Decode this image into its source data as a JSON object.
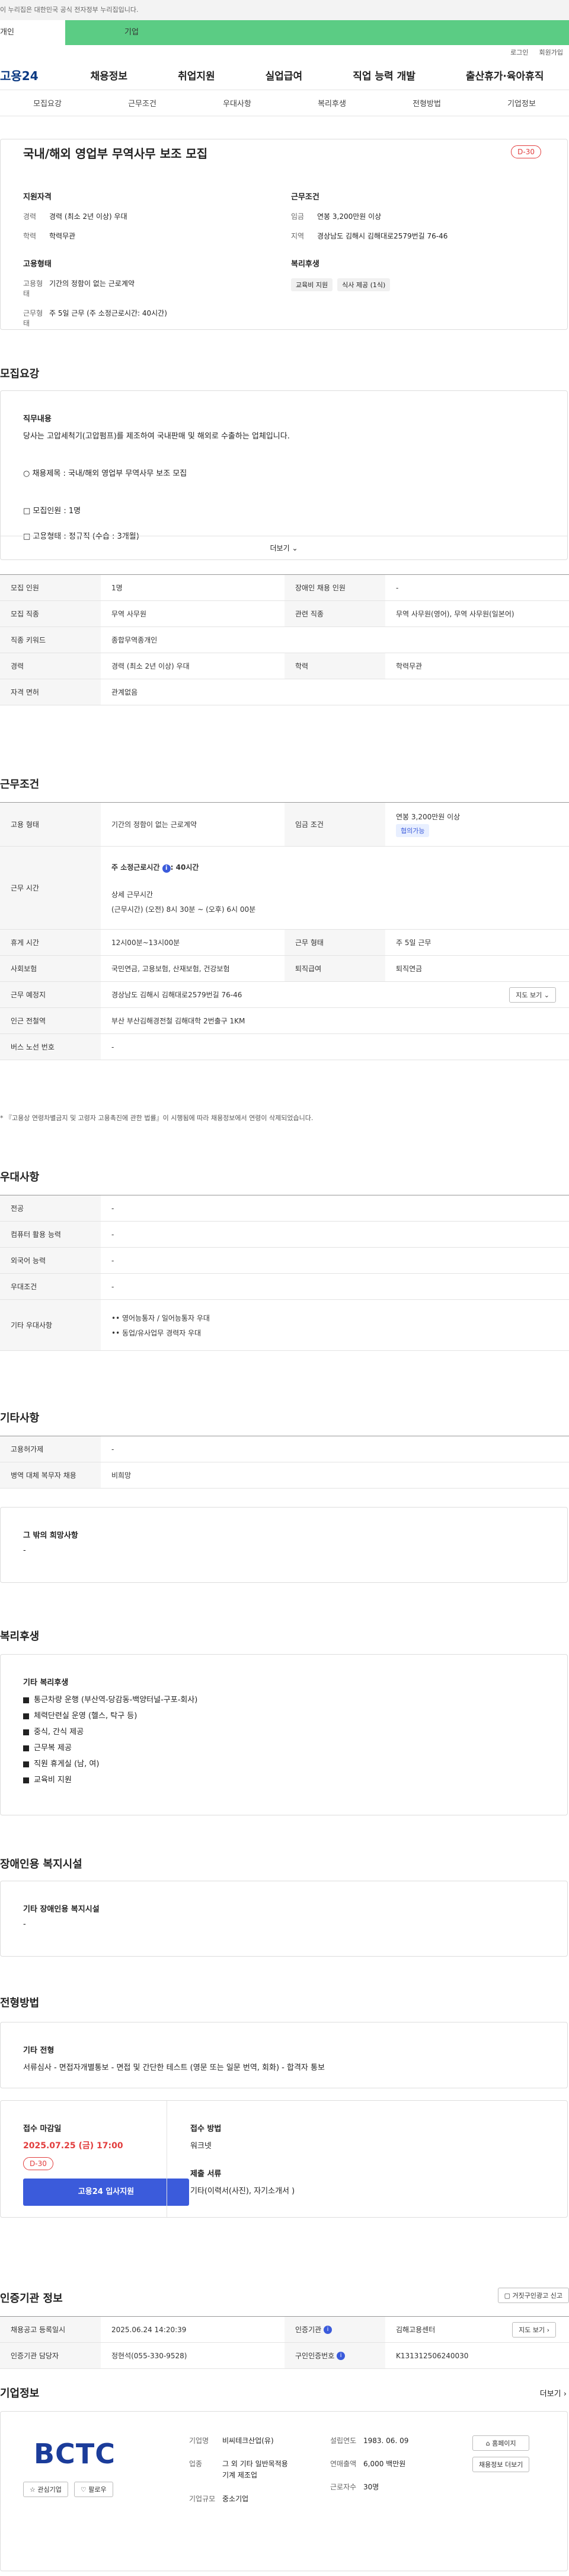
{
  "govbar": "이 누리집은 대한민국 공식 전자정부 누리집입니다.",
  "usertabs": [
    "개인",
    "기업"
  ],
  "top_links": [
    "로그인",
    "회원가입"
  ],
  "logo": "고용24",
  "gnb": [
    "채용정보",
    "취업지원",
    "실업급여",
    "직업 능력 개발",
    "출산휴가·육아휴직"
  ],
  "subnav": [
    "모집요강",
    "근무조건",
    "우대사항",
    "복리후생",
    "전형방법",
    "기업정보"
  ],
  "summary": {
    "title": "국내/해외 영업부 무역사무 보조 모집",
    "dday": "D-30",
    "qual_title": "지원자격",
    "career_k": "경력",
    "career_v": "경력 (최소 2년 이상) 우대",
    "edu_k": "학력",
    "edu_v": "학력무관",
    "cond_title": "근무조건",
    "wage_k": "임금",
    "wage_v": "연봉 3,200만원 이상",
    "area_k": "지역",
    "area_v": "경상남도 김해시 김해대로2579번길 76-46",
    "emp_title": "고용형태",
    "emptype_k": "고용형태",
    "emptype_v": "기간의 정함이 없는 근로계약",
    "workform_k": "근무형태",
    "workform_v": "주 5일 근무 (주 소정근로시간: 40시간)",
    "welfare_title": "복리후생",
    "chips": [
      "교육비 지원",
      "식사 제공 (1식)"
    ]
  },
  "recruit": {
    "title": "모집요강",
    "duty_title": "직무내용",
    "duty_desc": "당사는 고압세척기(고압펌프)를 제조하여 국내판매 및 해외로 수출하는 업체입니다.",
    "lines": [
      "○ 채용제목 : 국내/해외 영업부 무역사무 보조 모집",
      "□ 모집인원 : 1명",
      "□ 고용형태 : 정규직 (수습 : 3개월)"
    ],
    "more": "더보기",
    "rows": [
      [
        "모집 인원",
        "1명",
        "장애인 채용 인원",
        "-"
      ],
      [
        "모집 직종",
        "무역 사무원",
        "관련 직종",
        "무역 사무원(영어), 무역 사무원(일본어)"
      ],
      [
        "직종 키워드",
        "종합무역종개인",
        "",
        ""
      ],
      [
        "경력",
        "경력 (최소 2년 이상) 우대",
        "학력",
        "학력무관"
      ],
      [
        "자격 면허",
        "관계없음",
        "",
        ""
      ]
    ]
  },
  "work": {
    "title": "근무조건",
    "r1": [
      "고용 형태",
      "기간의 정함이 없는 근로계약",
      "임금 조건",
      "연봉 3,200만원 이상",
      "협의가능"
    ],
    "r2_k": "근무 시간",
    "r2_l1": "주 소정근로시간",
    "r2_l1b": "40시간",
    "r2_l2": "상세 근무시간",
    "r2_l3": "(근무시간) (오전) 8시 30분 ~ (오후) 6시 00분",
    "rows": [
      [
        "휴게 시간",
        "12시00분~13시00분",
        "근무 형태",
        "주 5일 근무"
      ],
      [
        "사회보험",
        "국민연금, 고용보험, 산재보험, 건강보험",
        "퇴직급여",
        "퇴직연금"
      ]
    ],
    "addr": [
      "근무 예정지",
      "경상남도 김해시 김해대로2579번길 76-46",
      "지도 보기"
    ],
    "rows2": [
      [
        "인근 전철역",
        "부산 부산김해경전철 김해대학 2번출구 1KM"
      ],
      [
        "버스 노선 번호",
        "-"
      ]
    ],
    "note": "* 『고용상 연령차별금지 및 고령자 고용촉진에 관한 법률』이 시행됨에 따라 채용정보에서 연령이 삭제되었습니다."
  },
  "pref": {
    "title": "우대사항",
    "rows": [
      [
        "전공",
        "-"
      ],
      [
        "컴퓨터 활용 능력",
        "-"
      ],
      [
        "외국어 능력",
        "-"
      ],
      [
        "우대조건",
        "-"
      ]
    ],
    "etc_k": "기타 우대사항",
    "etc": [
      "•• 영어능통자 / 일어능통자 우대",
      "•• 동업/유사업무 경력자 우대"
    ]
  },
  "etc": {
    "title": "기타사항",
    "rows": [
      [
        "고용허가제",
        "-"
      ],
      [
        "병역 대체 복무자 채용",
        "비희망"
      ]
    ],
    "hope_title": "그 밖의 희망사항",
    "hope": "-"
  },
  "welfare": {
    "title": "복리후생",
    "sub": "기타 복리후생",
    "items": [
      "통근차량 운행 (부산역-당감동-백양터널-구포-회사)",
      "체력단련실 운영 (헬스, 탁구 등)",
      "중식, 간식 제공",
      "근무복 제공",
      "직원 휴게실 (남, 여)",
      "교육비 지원"
    ]
  },
  "disabled": {
    "title": "장애인용 복지시설",
    "sub": "기타 장애인용 복지시설",
    "v": "-"
  },
  "screening": {
    "title": "전형방법",
    "sub": "기타 전형",
    "desc": "서류심사 - 면접자개별통보 - 면접 및 간단한 테스트 (영문 또는 일문 번역, 회화) - 합격자 통보",
    "deadline_t": "접수 마감일",
    "deadline": "2025.07.25 (금) 17:00",
    "dday": "D-30",
    "apply": "고용24 입사지원",
    "method_t": "접수 방법",
    "method": "워크넷",
    "docs_t": "제출 서류",
    "docs": "기타(이력서(사진), 자기소개서 )"
  },
  "agency": {
    "title": "인증기관 정보",
    "report": "거짓구인광고 신고",
    "rows": [
      [
        "채용공고 등록일시",
        "2025.06.24 14:20:39",
        "인증기관",
        "김해고용센터",
        "지도 보기"
      ],
      [
        "인증기관 담당자",
        "정현석(055-330-9528)",
        "구인인증번호",
        "K131312506240030",
        ""
      ]
    ]
  },
  "company": {
    "title": "기업정보",
    "more": "더보기",
    "logo": "BCTC",
    "fav": "관심기업",
    "follow": "팔로우",
    "f": [
      [
        "기업명",
        "비씨테크산업(유)",
        "설립연도",
        "1983. 06. 09"
      ],
      [
        "업종",
        "그 외 기타 일반목적용 기계 제조업",
        "연매출액",
        "6,000 백만원"
      ],
      [
        "",
        "",
        "근로자수",
        "30명"
      ],
      [
        "기업규모",
        "중소기업",
        "",
        ""
      ]
    ],
    "home": "홈페이지",
    "jobs": "채용정보 더보기"
  }
}
